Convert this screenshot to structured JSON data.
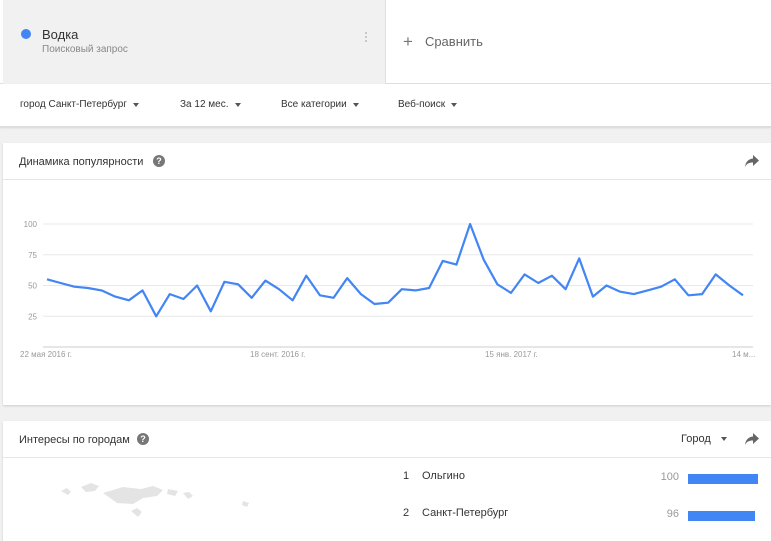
{
  "term": {
    "name": "Водка",
    "subtitle": "Поисковый запрос",
    "color": "#4285f4"
  },
  "compare_label": "Сравнить",
  "filters": [
    {
      "label": "город Санкт-Петербург"
    },
    {
      "label": "За 12 мес."
    },
    {
      "label": "Все категории"
    },
    {
      "label": "Веб-поиск"
    }
  ],
  "interest_card": {
    "title": "Динамика популярности",
    "help_icon": "question-circle-icon",
    "share_icon": "share-arrow-icon"
  },
  "chart_data": {
    "type": "line",
    "x_tick_labels": [
      "22 мая 2016 г.",
      "18 сент. 2016 г.",
      "15 янв. 2017 г.",
      "14 м..."
    ],
    "y_tick_labels": [
      "100",
      "75",
      "50",
      "25"
    ],
    "ylim": [
      0,
      100
    ],
    "grid": true,
    "series": [
      {
        "color": "#4285f4",
        "values": [
          55,
          52,
          49,
          48,
          46,
          41,
          38,
          46,
          25,
          43,
          39,
          50,
          29,
          53,
          51,
          40,
          54,
          47,
          38,
          58,
          42,
          40,
          56,
          43,
          35,
          36,
          47,
          46,
          48,
          70,
          67,
          100,
          71,
          51,
          44,
          59,
          52,
          58,
          47,
          72,
          41,
          50,
          45,
          43,
          46,
          49,
          55,
          42,
          43,
          59,
          50,
          42
        ]
      }
    ]
  },
  "region_card": {
    "title": "Интересы по городам",
    "help_icon": "question-circle-icon",
    "resolution_label": "Город",
    "share_icon": "share-arrow-icon",
    "bar_color": "#4285f4",
    "rows": [
      {
        "rank": "1",
        "name": "Ольгино",
        "value": "100",
        "fraction": 1.0
      },
      {
        "rank": "2",
        "name": "Санкт-Петербург",
        "value": "96",
        "fraction": 0.96
      }
    ]
  }
}
